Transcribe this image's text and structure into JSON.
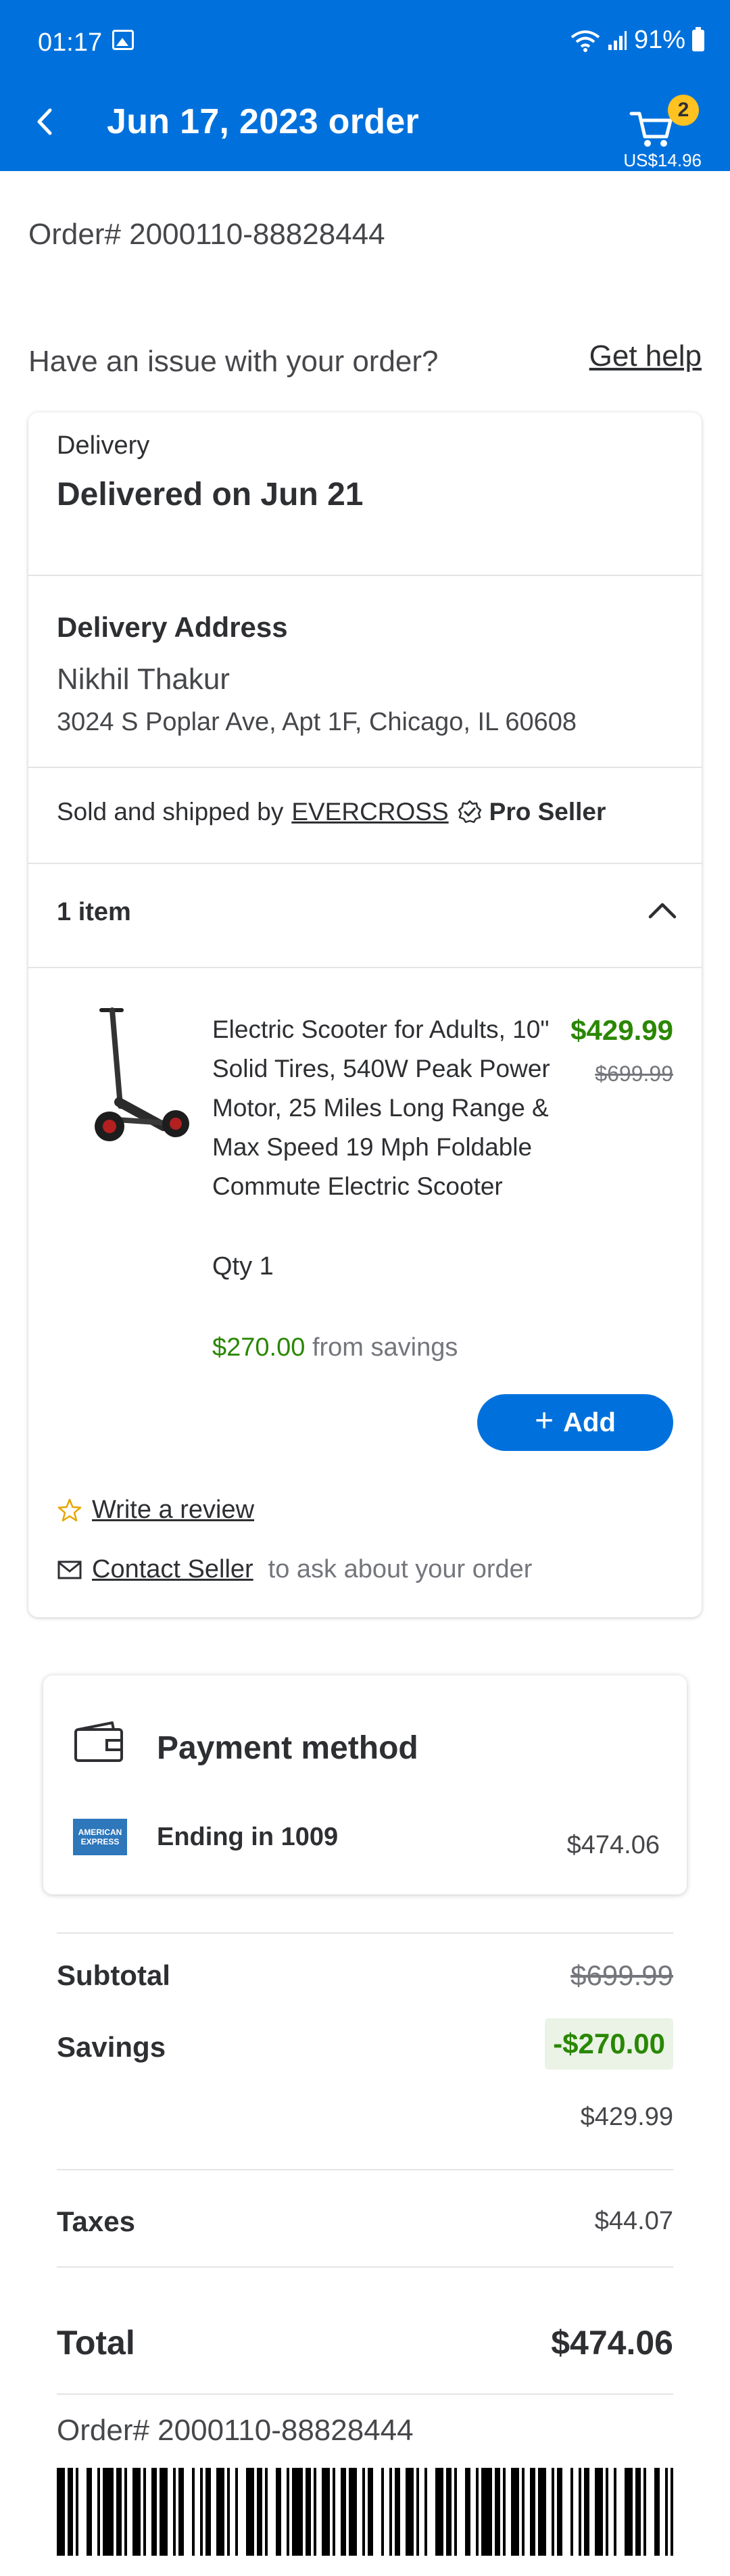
{
  "status_bar": {
    "time": "01:17",
    "battery": "91%"
  },
  "header": {
    "title": "Jun 17, 2023 order",
    "cart_count": "2",
    "cart_total": "US$14.96"
  },
  "order_number": "Order# 2000110-88828444",
  "issue": {
    "text": "Have an issue with your order?",
    "help_link": "Get help"
  },
  "delivery": {
    "label": "Delivery",
    "status": "Delivered on Jun 21"
  },
  "address": {
    "label": "Delivery Address",
    "name": "Nikhil Thakur",
    "line": "3024 S Poplar Ave, Apt 1F, Chicago, IL 60608"
  },
  "seller": {
    "prefix": "Sold and shipped by",
    "name": "EVERCROSS",
    "badge": "Pro Seller"
  },
  "items": {
    "count_label": "1 item",
    "list": [
      {
        "title": "Electric Scooter for Adults, 10\" Solid Tires, 540W Peak Power Motor, 25 Miles Long Range & Max Speed 19 Mph Foldable Commute Electric Scooter",
        "price": "$429.99",
        "was_price": "$699.99",
        "qty": "Qty 1",
        "savings": "$270.00",
        "savings_suffix": "from savings",
        "add_label": "Add"
      }
    ]
  },
  "actions": {
    "review": "Write a review",
    "contact": "Contact Seller",
    "contact_suffix": "to ask about your order"
  },
  "payment": {
    "title": "Payment method",
    "card_brand_line1": "AMERICAN",
    "card_brand_line2": "EXPRESS",
    "ending": "Ending in 1009",
    "amount": "$474.06"
  },
  "totals": {
    "subtotal_label": "Subtotal",
    "subtotal": "$699.99",
    "savings_label": "Savings",
    "savings": "-$270.00",
    "after_savings": "$429.99",
    "taxes_label": "Taxes",
    "taxes": "$44.07",
    "total_label": "Total",
    "total": "$474.06"
  },
  "colors": {
    "brand_blue": "#0071dc",
    "savings_green": "#2a8703",
    "badge_yellow": "#ffc220"
  }
}
